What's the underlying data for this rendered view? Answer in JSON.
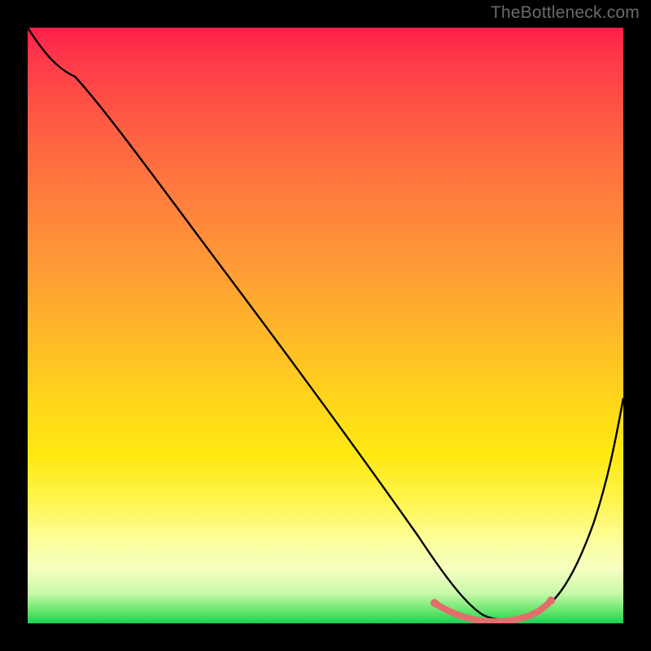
{
  "watermark": "TheBottleneck.com",
  "colors": {
    "frame": "#000000",
    "curve": "#000000",
    "marker": "#e26e6e",
    "gradient_top": "#ff1f4a",
    "gradient_bottom": "#19d153"
  },
  "chart_data": {
    "type": "line",
    "title": "",
    "xlabel": "",
    "ylabel": "",
    "xlim": [
      0,
      100
    ],
    "ylim": [
      0,
      100
    ],
    "x": [
      0,
      3,
      8,
      15,
      25,
      35,
      45,
      55,
      62,
      66,
      70,
      74,
      78,
      82,
      86,
      90,
      95,
      100
    ],
    "values": [
      100,
      95,
      92,
      86,
      74,
      62,
      49,
      36,
      24,
      14,
      6,
      2,
      0.5,
      1,
      3,
      8,
      20,
      38
    ],
    "series": [
      {
        "name": "bottleneck-curve",
        "x": [
          0,
          3,
          8,
          15,
          25,
          35,
          45,
          55,
          62,
          66,
          70,
          74,
          78,
          82,
          86,
          90,
          95,
          100
        ],
        "y": [
          100,
          95,
          92,
          86,
          74,
          62,
          49,
          36,
          24,
          14,
          6,
          2,
          0.5,
          1,
          3,
          8,
          20,
          38
        ]
      },
      {
        "name": "optimal-range-highlight",
        "x": [
          68,
          70,
          72,
          74,
          76,
          78,
          80,
          82,
          84
        ],
        "y": [
          3.5,
          2.2,
          1.3,
          0.8,
          0.6,
          0.7,
          1.0,
          1.6,
          2.6
        ]
      }
    ],
    "annotations": []
  }
}
